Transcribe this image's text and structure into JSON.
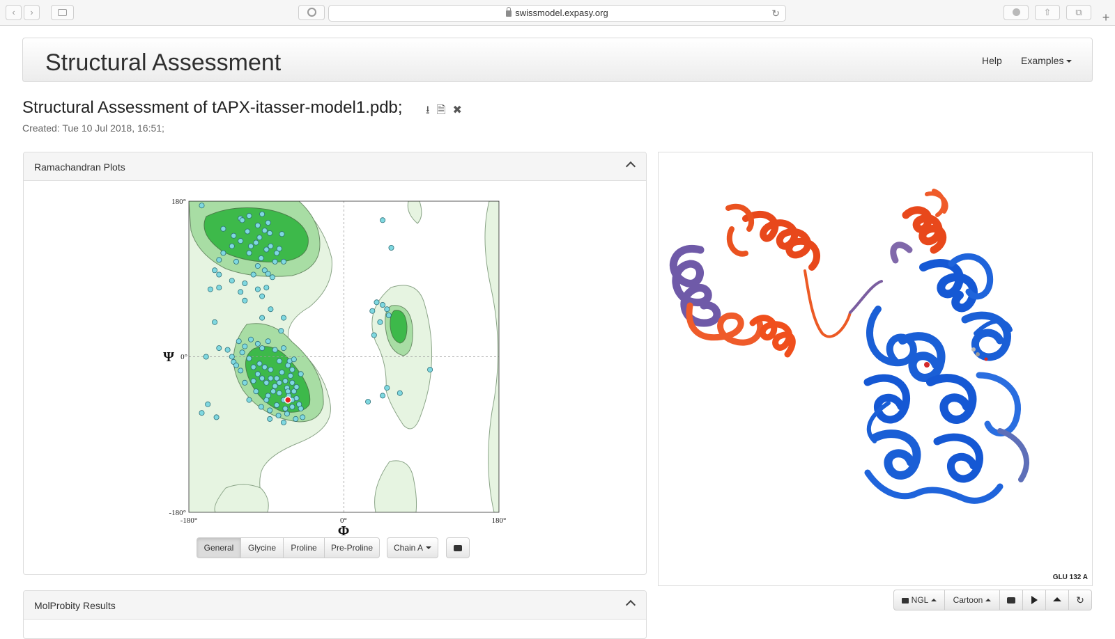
{
  "browser": {
    "url": "swissmodel.expasy.org"
  },
  "header": {
    "title": "Structural Assessment",
    "nav": [
      {
        "label": "Help"
      },
      {
        "label": "Examples"
      }
    ]
  },
  "page": {
    "heading": "Structural Assessment of tAPX-itasser-model1.pdb;",
    "created": "Created: Tue 10 Jul 2018, 16:51;"
  },
  "ramachandran": {
    "panel_title": "Ramachandran Plots",
    "buttons": [
      "General",
      "Glycine",
      "Proline",
      "Pre-Proline"
    ],
    "chain_label": "Chain A"
  },
  "molprobity": {
    "panel_title": "MolProbity Results"
  },
  "viewer": {
    "selection_label": "GLU 132 A",
    "toolbar": {
      "engine_label": "NGL",
      "style_label": "Cartoon"
    }
  },
  "chart_data": {
    "type": "scatter",
    "xlabel": "Φ",
    "ylabel": "Ψ",
    "xlim": [
      -180,
      180
    ],
    "ylim": [
      -180,
      180
    ],
    "x_ticks": [
      "-180°",
      "0°",
      "180°"
    ],
    "y_ticks": [
      "180°",
      "0°",
      "-180°"
    ],
    "colors": {
      "residue": "#7fd8e0",
      "highlight": "#e8211f",
      "favored": "#3db94a",
      "allowed": "#a8dda4",
      "generous": "#e6f4e1"
    },
    "points": [
      [
        -165,
        175
      ],
      [
        -110,
        163
      ],
      [
        -95,
        165
      ],
      [
        -120,
        160
      ],
      [
        -88,
        155
      ],
      [
        -100,
        152
      ],
      [
        -118,
        158
      ],
      [
        -92,
        146
      ],
      [
        -112,
        145
      ],
      [
        -86,
        143
      ],
      [
        -140,
        148
      ],
      [
        -128,
        140
      ],
      [
        -98,
        138
      ],
      [
        -102,
        132
      ],
      [
        -120,
        134
      ],
      [
        -108,
        128
      ],
      [
        -85,
        128
      ],
      [
        -90,
        124
      ],
      [
        -110,
        120
      ],
      [
        -75,
        125
      ],
      [
        -72,
        142
      ],
      [
        -78,
        120
      ],
      [
        -130,
        128
      ],
      [
        -96,
        114
      ],
      [
        -125,
        110
      ],
      [
        -145,
        112
      ],
      [
        -140,
        120
      ],
      [
        -150,
        100
      ],
      [
        -100,
        105
      ],
      [
        -80,
        110
      ],
      [
        -92,
        100
      ],
      [
        -88,
        96
      ],
      [
        -70,
        110
      ],
      [
        -83,
        92
      ],
      [
        -105,
        95
      ],
      [
        -145,
        95
      ],
      [
        -130,
        88
      ],
      [
        -145,
        80
      ],
      [
        -115,
        85
      ],
      [
        -100,
        78
      ],
      [
        -120,
        75
      ],
      [
        -90,
        80
      ],
      [
        -95,
        70
      ],
      [
        -115,
        65
      ],
      [
        -155,
        78
      ],
      [
        -85,
        55
      ],
      [
        -150,
        40
      ],
      [
        -95,
        45
      ],
      [
        -70,
        45
      ],
      [
        -73,
        30
      ],
      [
        -145,
        10
      ],
      [
        -135,
        8
      ],
      [
        -130,
        0
      ],
      [
        -128,
        -6
      ],
      [
        -125,
        -10
      ],
      [
        -120,
        -16
      ],
      [
        -118,
        5
      ],
      [
        -110,
        -2
      ],
      [
        -105,
        -12
      ],
      [
        -100,
        -20
      ],
      [
        -98,
        -8
      ],
      [
        -95,
        -25
      ],
      [
        -90,
        -30
      ],
      [
        -85,
        -15
      ],
      [
        -80,
        -34
      ],
      [
        -75,
        -42
      ],
      [
        -70,
        -50
      ],
      [
        -65,
        -10
      ],
      [
        -62,
        -22
      ],
      [
        -60,
        -30
      ],
      [
        -58,
        -40
      ],
      [
        -55,
        -48
      ],
      [
        -52,
        -55
      ],
      [
        -50,
        -60
      ],
      [
        -48,
        -70
      ],
      [
        -66,
        -36
      ],
      [
        -64,
        -45
      ],
      [
        -68,
        -28
      ],
      [
        -60,
        -58
      ],
      [
        -72,
        -18
      ],
      [
        -78,
        -25
      ],
      [
        -82,
        -40
      ],
      [
        -88,
        -45
      ],
      [
        -92,
        -12
      ],
      [
        -102,
        -40
      ],
      [
        -110,
        -50
      ],
      [
        -115,
        -30
      ],
      [
        -96,
        -58
      ],
      [
        -86,
        -62
      ],
      [
        -76,
        -68
      ],
      [
        -66,
        -66
      ],
      [
        -56,
        -72
      ],
      [
        -60,
        -15
      ],
      [
        -63,
        -5
      ],
      [
        -58,
        -3
      ],
      [
        -75,
        -5
      ],
      [
        -80,
        8
      ],
      [
        -95,
        10
      ],
      [
        -100,
        15
      ],
      [
        -108,
        20
      ],
      [
        -115,
        12
      ],
      [
        -122,
        18
      ],
      [
        -88,
        18
      ],
      [
        -70,
        10
      ],
      [
        -160,
        0
      ],
      [
        -165,
        -65
      ],
      [
        -158,
        -55
      ],
      [
        -148,
        -70
      ],
      [
        -70,
        -76
      ],
      [
        -86,
        -72
      ],
      [
        -105,
        -28
      ],
      [
        -90,
        -50
      ],
      [
        -68,
        -60
      ],
      [
        -78,
        -56
      ],
      [
        -60,
        -50
      ],
      [
        -65,
        -40
      ],
      [
        -75,
        -30
      ],
      [
        -85,
        -25
      ],
      [
        -55,
        -35
      ],
      [
        -50,
        -20
      ],
      [
        45,
        158
      ],
      [
        55,
        126
      ],
      [
        38,
        63
      ],
      [
        45,
        60
      ],
      [
        50,
        55
      ],
      [
        33,
        53
      ],
      [
        42,
        40
      ],
      [
        52,
        48
      ],
      [
        35,
        25
      ],
      [
        100,
        -15
      ],
      [
        50,
        -36
      ],
      [
        45,
        -45
      ],
      [
        65,
        -42
      ],
      [
        28,
        -52
      ]
    ],
    "highlight": [
      [
        -65,
        -50
      ]
    ]
  }
}
